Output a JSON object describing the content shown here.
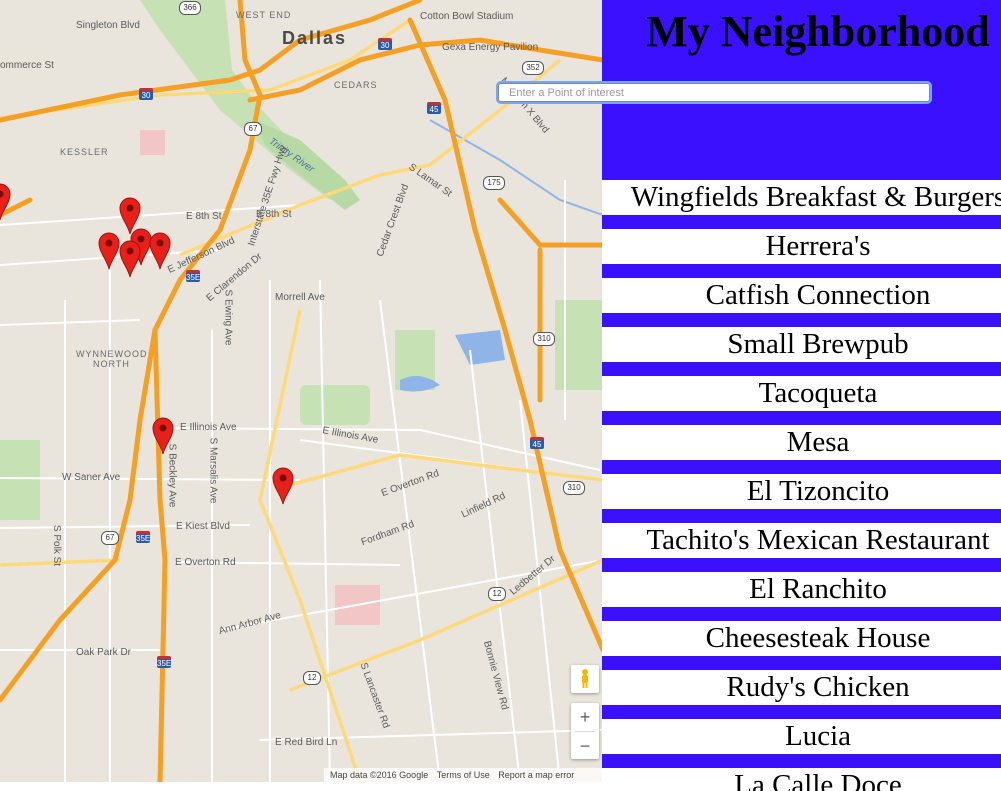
{
  "sidebar": {
    "title": "My Neighborhood",
    "search": {
      "placeholder": "Enter a Point of interest",
      "value": ""
    },
    "places": [
      "Wingfields Breakfast & Burgers",
      "Herrera's",
      "Catfish Connection",
      "Small Brewpub",
      "Tacoqueta",
      "Mesa",
      "El Tizoncito",
      "Tachito's Mexican Restaurant",
      "El Ranchito",
      "Cheesesteak House",
      "Rudy's Chicken",
      "Lucia",
      "La Calle Doce"
    ]
  },
  "map": {
    "labels": {
      "dallas": "Dallas",
      "west_end": "WEST END",
      "singleton": "Singleton Blvd",
      "commerce": "ommerce St",
      "cotton_bowl": "Cotton Bowl Stadium",
      "gexa": "Gexa Energy Pavilion",
      "cedars": "CEDARS",
      "kessler": "KESSLER",
      "trinity": "Trinity River",
      "malcolm": "Malcolm X Blvd",
      "lamar": "S Lamar St",
      "cedar_crest": "Cedar Crest Blvd",
      "e8th": "E 8th St",
      "e8th2": "E 8th St",
      "jefferson": "E Jefferson Blvd",
      "clarendon": "E Clarendon Dr",
      "morrell": "Morrell Ave",
      "wynnewood": "WYNNEWOOD",
      "north": "NORTH",
      "illinois": "E Illinois Ave",
      "illinois2": "E Illinois Ave",
      "saner": "W Saner Ave",
      "kiest": "E Kiest Blvd",
      "overton": "E Overton Rd",
      "overton2": "E Overton Rd",
      "fordham": "Fordham Rd",
      "ann_arbor": "Ann Arbor Ave",
      "oak_park": "Oak Park Dr",
      "red_bird": "E Red Bird Ln",
      "bonnie_view": "Bonnie View Rd",
      "lancaster": "S Lancaster Rd",
      "marsalis": "S Marsalis Ave",
      "ewing": "S Ewing Ave",
      "beckley": "S Beckley Ave",
      "polk": "S Polk St",
      "ledbetter": "Ledbetter Dr",
      "linfield": "Linfield Rd",
      "kiest_blvd": "E Kiest Blvd",
      "fwy_35e": "Interstate 35E Fwy Hwy"
    },
    "shields": {
      "i30a": "30",
      "i30b": "30",
      "i45a": "45",
      "i45b": "45",
      "i35ea": "35E",
      "i35eb": "35E",
      "i35ec": "35E",
      "us67a": "67",
      "us67b": "67",
      "us175": "175",
      "s352": "352",
      "s310a": "310",
      "s310b": "310",
      "s12a": "12",
      "s12b": "12",
      "s366": "366"
    },
    "footer": {
      "map_data": "Map data ©2016 Google",
      "terms": "Terms of Use",
      "report": "Report a map error"
    },
    "zoom_in": "+",
    "zoom_out": "−"
  }
}
